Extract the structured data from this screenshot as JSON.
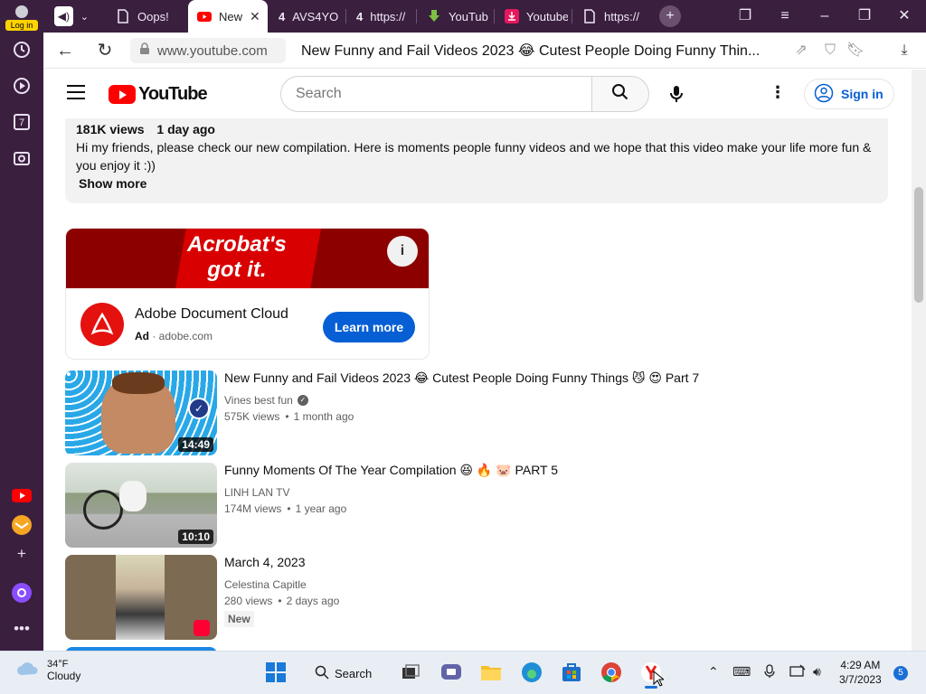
{
  "sidebar": {
    "login_label": "Log in",
    "tab_count": "7"
  },
  "tabs": [
    {
      "label": "Oops!",
      "icon": "document-icon"
    },
    {
      "label": "New",
      "icon": "youtube-icon",
      "active": true
    },
    {
      "label": "AVS4YO",
      "icon": "number-icon",
      "badge": "4"
    },
    {
      "label": "https://",
      "icon": "number-icon",
      "badge": "4"
    },
    {
      "label": "YouTub",
      "icon": "download-icon"
    },
    {
      "label": "Youtube",
      "icon": "download-pink-icon"
    },
    {
      "label": "https://",
      "icon": "document-icon"
    }
  ],
  "addressbar": {
    "domain": "www.youtube.com",
    "page_title": "New Funny and Fail Videos 2023 😂 Cutest People Doing Funny Thin..."
  },
  "youtube": {
    "logo_text": "YouTube",
    "search_placeholder": "Search",
    "signin_label": "Sign in"
  },
  "description": {
    "views": "181K views",
    "age": "1 day ago",
    "text": "Hi my friends, please check our new compilation. Here is moments people funny videos and we hope that this video make your life more fun & you enjoy it :))",
    "show_more": "Show more"
  },
  "ad": {
    "banner_line1": "Acrobat's",
    "banner_line2": "got it.",
    "title": "Adobe Document Cloud",
    "ad_label": "Ad",
    "domain": "adobe.com",
    "cta": "Learn more"
  },
  "videos": [
    {
      "title": "New Funny and Fail Videos 2023 😂 Cutest People Doing Funny Things 😼 😍 Part 7",
      "channel": "Vines best fun",
      "verified": true,
      "views": "575K views",
      "age": "1 month ago",
      "duration": "14:49"
    },
    {
      "title": "Funny Moments Of The Year Compilation 😆 🔥 🐷 PART 5",
      "channel": "LINH LAN TV",
      "views": "174M views",
      "age": "1 year ago",
      "duration": "10:10"
    },
    {
      "title": "March 4, 2023",
      "channel": "Celestina Capitle",
      "views": "280 views",
      "age": "2 days ago",
      "badge": "New",
      "short": true
    }
  ],
  "taskbar": {
    "temperature": "34°F",
    "condition": "Cloudy",
    "search_label": "Search",
    "time": "4:29 AM",
    "date": "3/7/2023",
    "notifications": "5"
  },
  "colors": {
    "browser_chrome": "#3a1f3f",
    "youtube_red": "#ff0000",
    "link_blue": "#065fd4",
    "adobe_red": "#e4110f"
  }
}
